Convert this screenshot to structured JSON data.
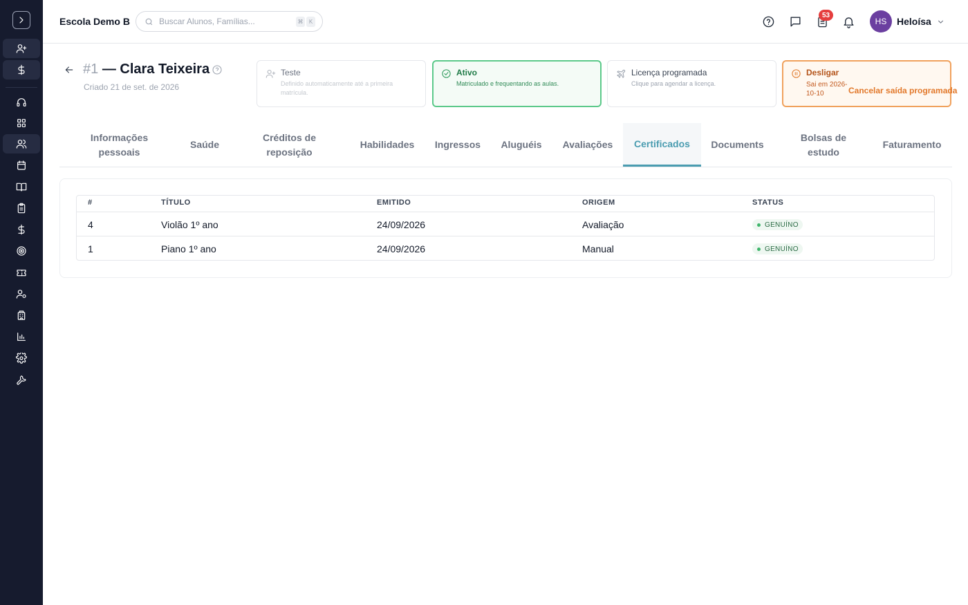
{
  "topbar": {
    "school_name": "Escola Demo B",
    "search_placeholder": "Buscar Alunos, Famílias...",
    "shortcut_keys": [
      "⌘",
      "K"
    ],
    "notification_count": "53",
    "user_initials": "HS",
    "user_name": "Heloísa"
  },
  "sidebar": {
    "icons": [
      "chevron-right-icon",
      "user-plus-icon",
      "dollar-icon",
      "headset-icon",
      "grid-icon",
      "users-icon",
      "calendar-icon",
      "book-open-icon",
      "clipboard-icon",
      "dollar-icon",
      "target-icon",
      "ticket-icon",
      "user-cog-icon",
      "building-icon",
      "bar-chart-icon",
      "gear-icon",
      "wrench-icon"
    ]
  },
  "student": {
    "number": "#1",
    "name": "— Clara Teixeira",
    "created": "Criado 21 de set. de 2026"
  },
  "status_cards": [
    {
      "title": "Teste",
      "desc": "Definido automaticamente até a primeira matrícula.",
      "icon": "user-plus-icon"
    },
    {
      "title": "Ativo",
      "desc": "Matriculado e frequentando as aulas.",
      "icon": "check-circle-icon"
    },
    {
      "title": "Licença programada",
      "desc": "Clique para agendar a licença.",
      "icon": "plane-icon"
    },
    {
      "title": "Desligar",
      "desc": "Sai em 2026-10-10",
      "action": "Cancelar saída programada",
      "icon": "pause-circle-icon"
    }
  ],
  "tabs": [
    "Informações pessoais",
    "Saúde",
    "Créditos de reposição",
    "Habilidades",
    "Ingressos",
    "Aluguéis",
    "Avaliações",
    "Certificados",
    "Documents",
    "Bolsas de estudo",
    "Faturamento"
  ],
  "active_tab": "Certificados",
  "table": {
    "headers": [
      "#",
      "TÍTULO",
      "EMITIDO",
      "ORIGEM",
      "STATUS"
    ],
    "rows": [
      {
        "id": "4",
        "title": "Violão 1º ano",
        "issued": "24/09/2026",
        "origin": "Avaliação",
        "status": "GENUÍNO"
      },
      {
        "id": "1",
        "title": "Piano 1º ano",
        "issued": "24/09/2026",
        "origin": "Manual",
        "status": "GENUÍNO"
      }
    ]
  },
  "colors": {
    "sidebar": "#161b2e",
    "accent_tab": "#4a9cb0",
    "active_green": "#5cc98a",
    "desligar_orange": "#f0a15c",
    "badge_red": "#e53e3e",
    "avatar_purple": "#6b3fa0"
  }
}
